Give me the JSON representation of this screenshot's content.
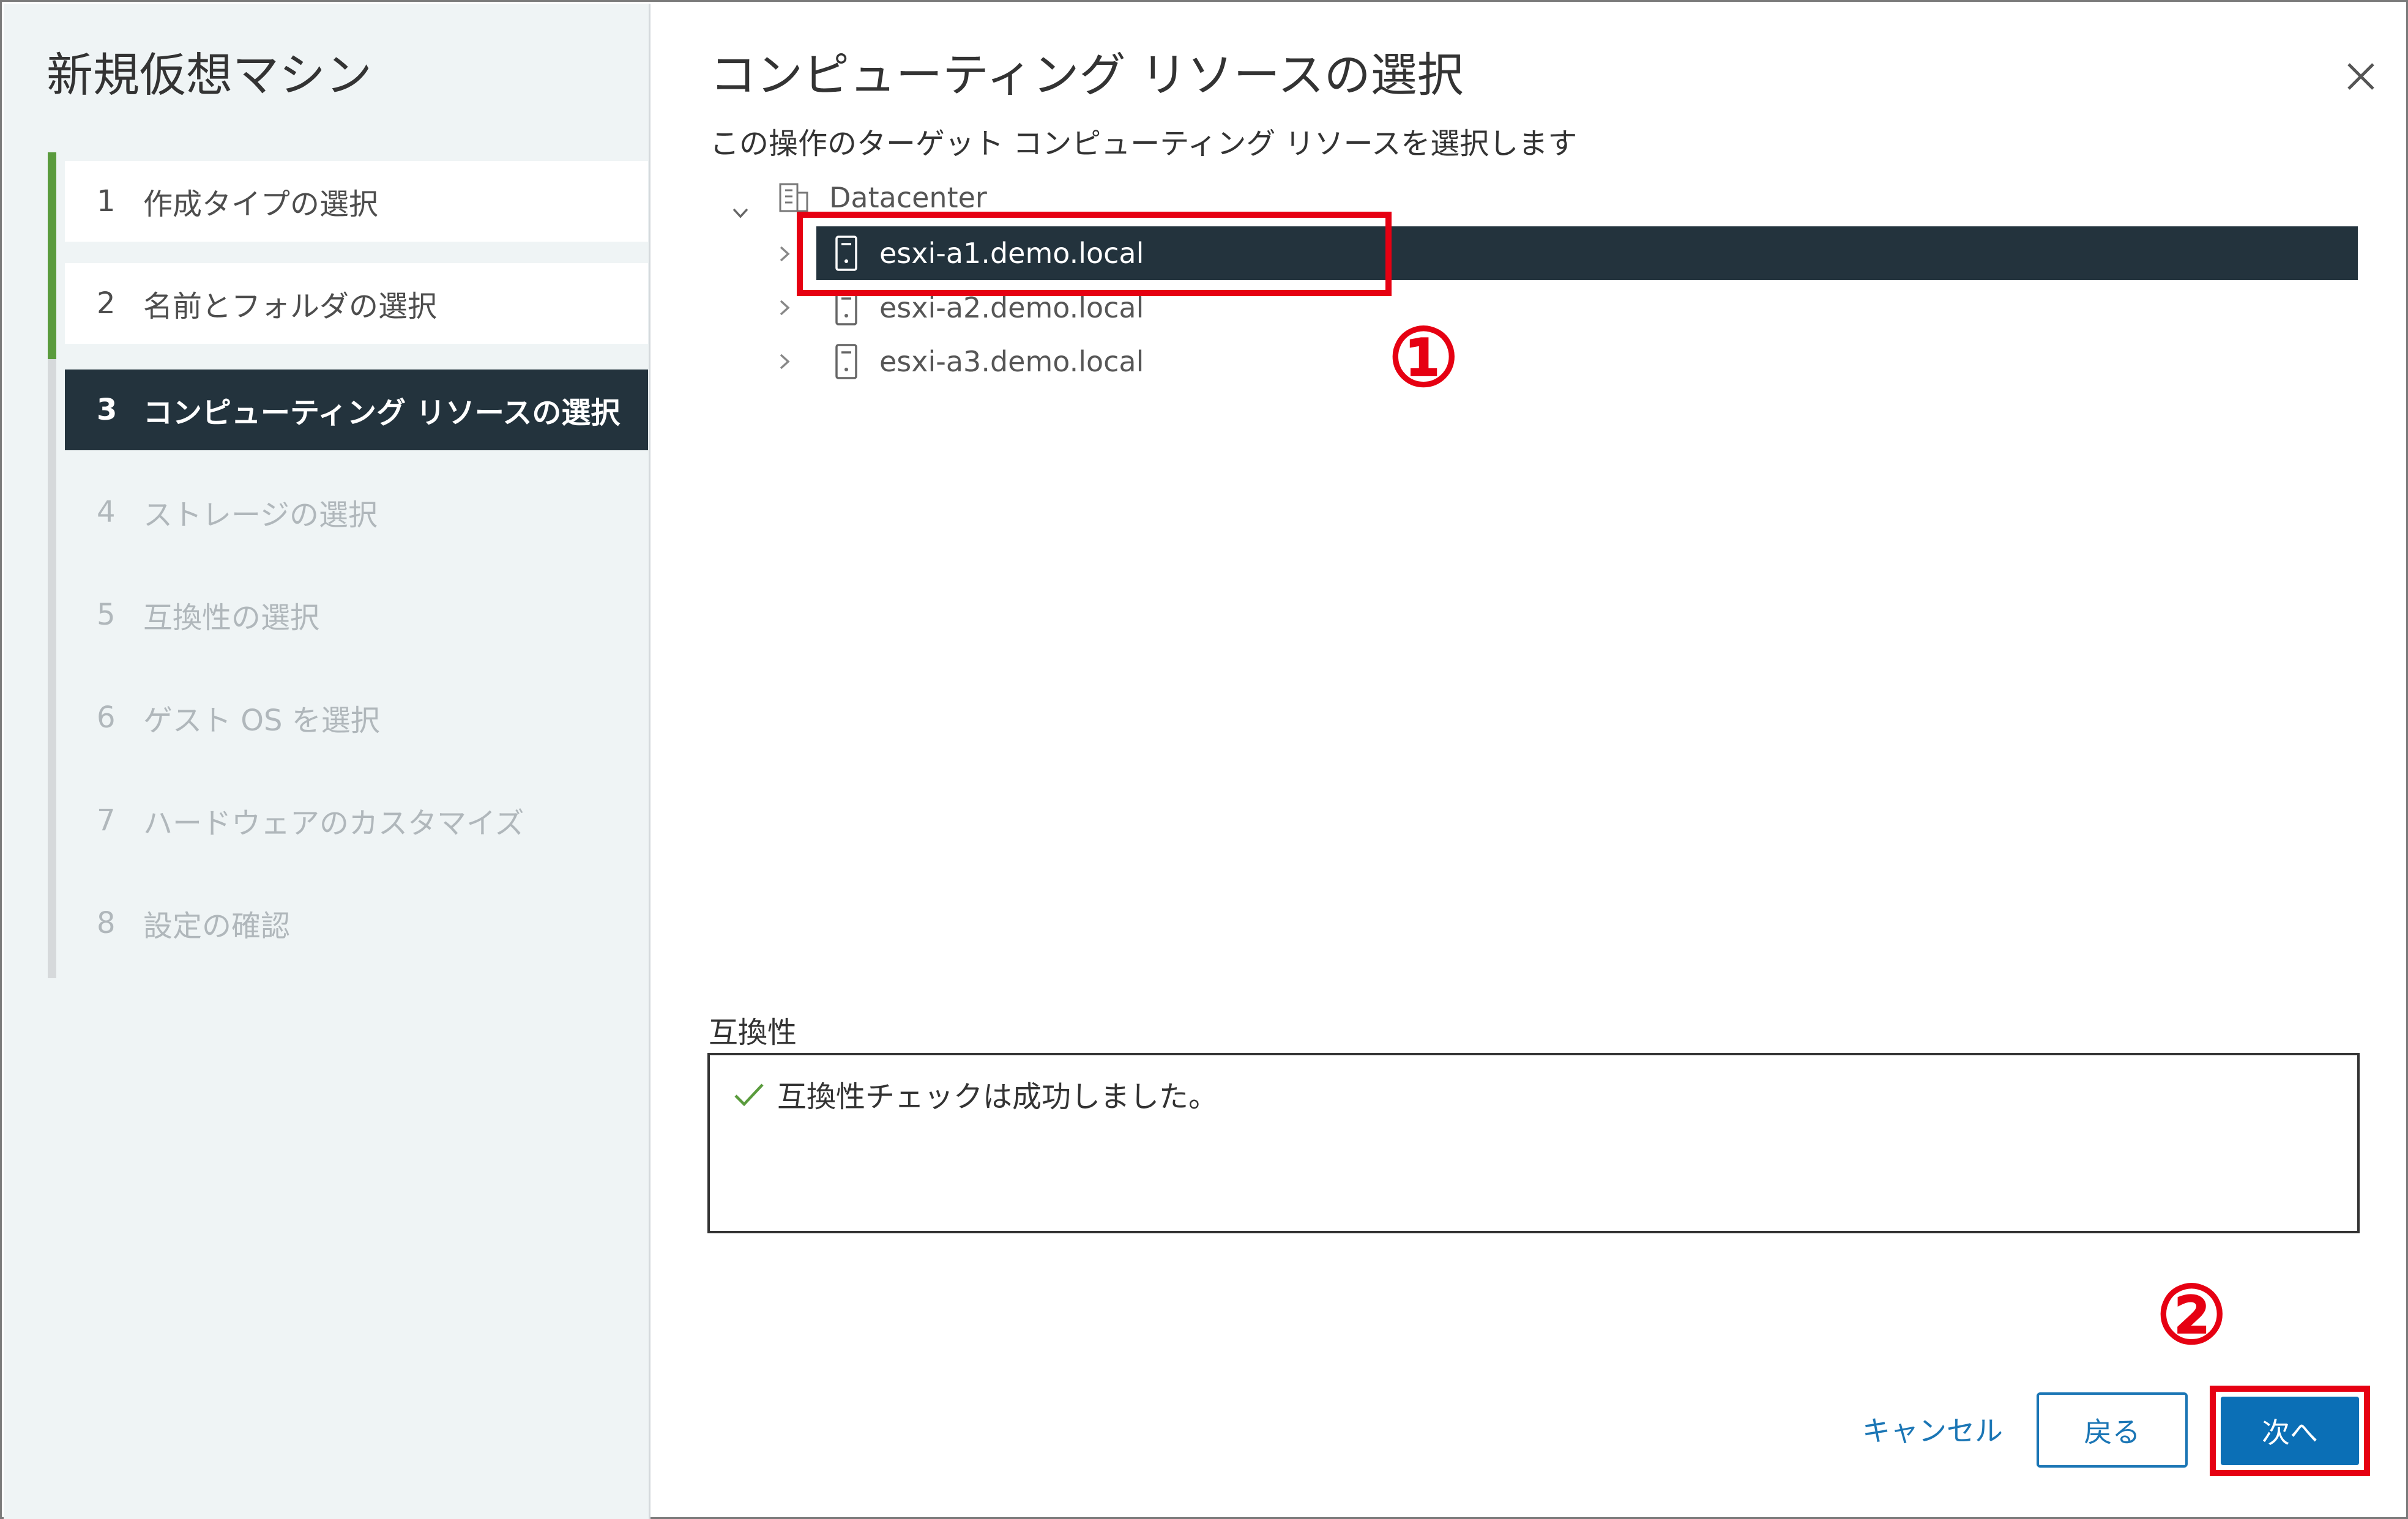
{
  "wizard": {
    "title": "新規仮想マシン",
    "steps": [
      {
        "num": "1",
        "label": "作成タイプの選択",
        "state": "done"
      },
      {
        "num": "2",
        "label": "名前とフォルダの選択",
        "state": "done"
      },
      {
        "num": "3",
        "label": "コンピューティング リソースの選択",
        "state": "active"
      },
      {
        "num": "4",
        "label": "ストレージの選択",
        "state": "pending"
      },
      {
        "num": "5",
        "label": "互換性の選択",
        "state": "pending"
      },
      {
        "num": "6",
        "label": "ゲスト OS を選択",
        "state": "pending"
      },
      {
        "num": "7",
        "label": "ハードウェアのカスタマイズ",
        "state": "pending"
      },
      {
        "num": "8",
        "label": "設定の確認",
        "state": "pending"
      }
    ]
  },
  "main": {
    "title": "コンピューティング リソースの選択",
    "subtitle": "この操作のターゲット コンピューティング リソースを選択します",
    "tree": {
      "datacenter": {
        "label": "Datacenter",
        "icon": "building-icon"
      },
      "hosts": [
        {
          "label": "esxi-a1.demo.local",
          "selected": true,
          "icon": "host-icon"
        },
        {
          "label": "esxi-a2.demo.local",
          "selected": false,
          "icon": "host-icon"
        },
        {
          "label": "esxi-a3.demo.local",
          "selected": false,
          "icon": "host-icon"
        }
      ]
    },
    "compatibility": {
      "label": "互換性",
      "message": "互換性チェックは成功しました。",
      "status_icon": "check-icon"
    }
  },
  "footer": {
    "cancel": "キャンセル",
    "back": "戻る",
    "next": "次へ"
  },
  "annotations": {
    "marker1": "①",
    "marker2": "②"
  },
  "colors": {
    "active_step_bg": "#23333d",
    "done_rail": "#5a9b3d",
    "primary_button": "#0b6fb6",
    "link": "#1b76b5",
    "callout_red": "#e60012"
  }
}
